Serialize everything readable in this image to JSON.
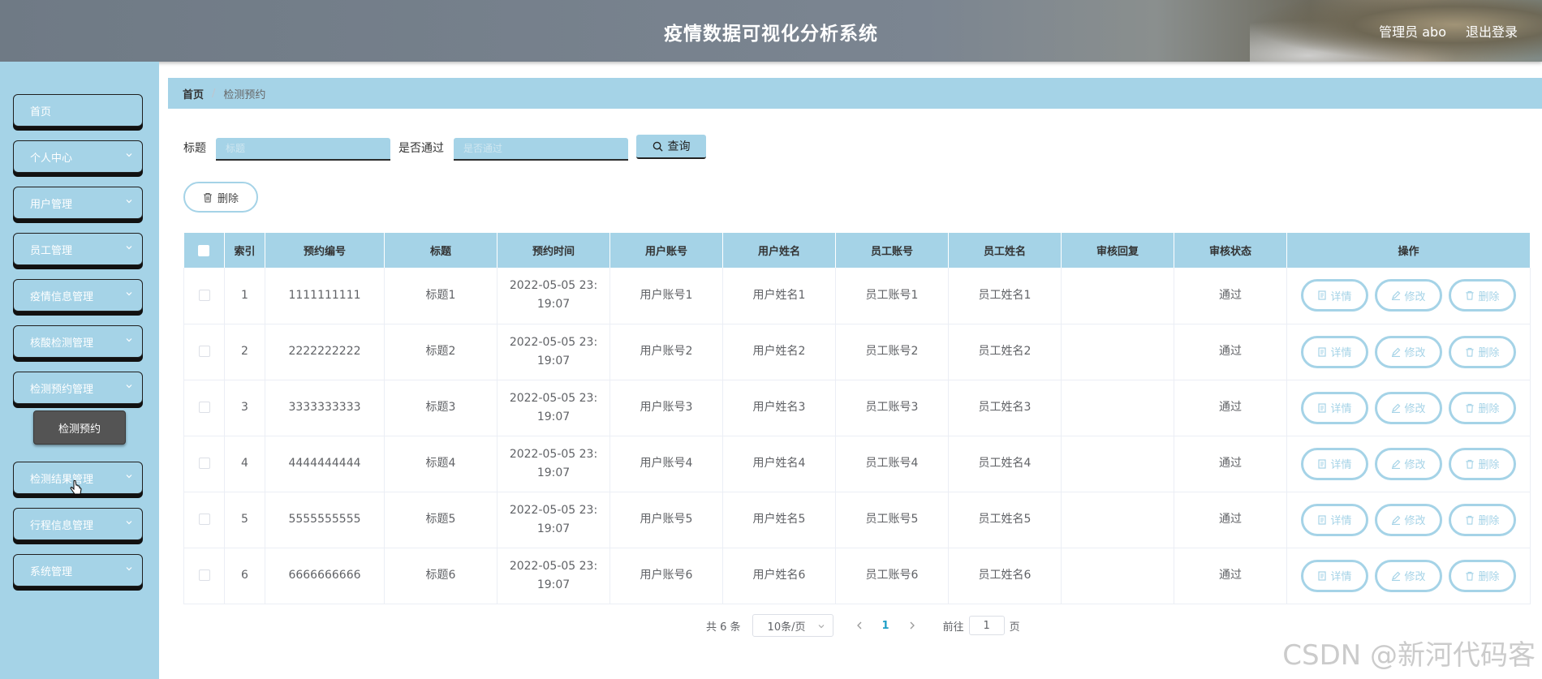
{
  "header": {
    "title": "疫情数据可视化分析系统",
    "user": "管理员 abo",
    "logout": "退出登录"
  },
  "sidebar": {
    "items": [
      {
        "label": "首页"
      },
      {
        "label": "个人中心"
      },
      {
        "label": "用户管理"
      },
      {
        "label": "员工管理"
      },
      {
        "label": "疫情信息管理"
      },
      {
        "label": "核酸检测管理"
      },
      {
        "label": "检测预约管理"
      },
      {
        "label": "检测结果管理"
      },
      {
        "label": "行程信息管理"
      },
      {
        "label": "系统管理"
      }
    ],
    "submenu": {
      "label": "检测预约"
    }
  },
  "breadcrumb": {
    "home": "首页",
    "separator": "/",
    "current": "检测预约"
  },
  "search": {
    "title_label": "标题",
    "title_placeholder": "标题",
    "pass_label": "是否通过",
    "pass_placeholder": "是否通过",
    "query_label": "查询"
  },
  "toolbar": {
    "delete_label": "删除"
  },
  "table": {
    "headers": [
      "",
      "索引",
      "预约编号",
      "标题",
      "预约时间",
      "用户账号",
      "用户姓名",
      "员工账号",
      "员工姓名",
      "审核回复",
      "审核状态",
      "操作"
    ],
    "rows": [
      {
        "index": "1",
        "code": "1111111111",
        "title": "标题1",
        "time": "2022-05-05 23:19:07",
        "user_account": "用户账号1",
        "user_name": "用户姓名1",
        "staff_account": "员工账号1",
        "staff_name": "员工姓名1",
        "reply": "",
        "status": "通过"
      },
      {
        "index": "2",
        "code": "2222222222",
        "title": "标题2",
        "time": "2022-05-05 23:19:07",
        "user_account": "用户账号2",
        "user_name": "用户姓名2",
        "staff_account": "员工账号2",
        "staff_name": "员工姓名2",
        "reply": "",
        "status": "通过"
      },
      {
        "index": "3",
        "code": "3333333333",
        "title": "标题3",
        "time": "2022-05-05 23:19:07",
        "user_account": "用户账号3",
        "user_name": "用户姓名3",
        "staff_account": "员工账号3",
        "staff_name": "员工姓名3",
        "reply": "",
        "status": "通过"
      },
      {
        "index": "4",
        "code": "4444444444",
        "title": "标题4",
        "time": "2022-05-05 23:19:07",
        "user_account": "用户账号4",
        "user_name": "用户姓名4",
        "staff_account": "员工账号4",
        "staff_name": "员工姓名4",
        "reply": "",
        "status": "通过"
      },
      {
        "index": "5",
        "code": "5555555555",
        "title": "标题5",
        "time": "2022-05-05 23:19:07",
        "user_account": "用户账号5",
        "user_name": "用户姓名5",
        "staff_account": "员工账号5",
        "staff_name": "员工姓名5",
        "reply": "",
        "status": "通过"
      },
      {
        "index": "6",
        "code": "6666666666",
        "title": "标题6",
        "time": "2022-05-05 23:19:07",
        "user_account": "用户账号6",
        "user_name": "用户姓名6",
        "staff_account": "员工账号6",
        "staff_name": "员工姓名6",
        "reply": "",
        "status": "通过"
      }
    ],
    "actions": {
      "detail": "详情",
      "edit": "修改",
      "delete": "删除"
    }
  },
  "pagination": {
    "total": "共 6 条",
    "page_size": "10条/页",
    "current_page": "1",
    "goto_prefix": "前往",
    "goto_value": "1",
    "goto_suffix": "页"
  },
  "watermark": "CSDN @新河代码客",
  "colors": {
    "accent": "#a5d3e7",
    "header": "#7b8591",
    "submenu": "#545454"
  }
}
